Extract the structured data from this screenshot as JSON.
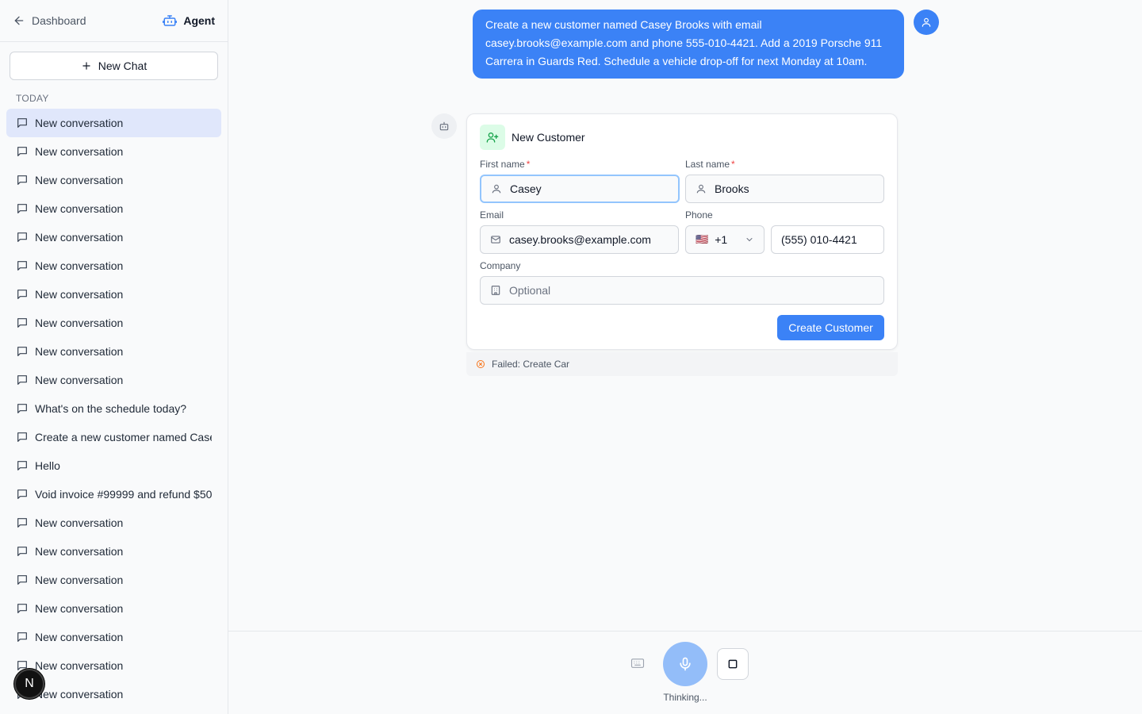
{
  "sidebar": {
    "back_label": "Dashboard",
    "agent_label": "Agent",
    "new_chat_label": "New Chat",
    "section_label": "TODAY",
    "items": [
      {
        "label": "New conversation"
      },
      {
        "label": "New conversation"
      },
      {
        "label": "New conversation"
      },
      {
        "label": "New conversation"
      },
      {
        "label": "New conversation"
      },
      {
        "label": "New conversation"
      },
      {
        "label": "New conversation"
      },
      {
        "label": "New conversation"
      },
      {
        "label": "New conversation"
      },
      {
        "label": "New conversation"
      },
      {
        "label": "What's on the schedule today?"
      },
      {
        "label": "Create a new customer named Case"
      },
      {
        "label": "Hello"
      },
      {
        "label": "Void invoice #99999 and refund $50"
      },
      {
        "label": "New conversation"
      },
      {
        "label": "New conversation"
      },
      {
        "label": "New conversation"
      },
      {
        "label": "New conversation"
      },
      {
        "label": "New conversation"
      },
      {
        "label": "New conversation"
      },
      {
        "label": "New conversation"
      }
    ],
    "badge_letter": "N"
  },
  "chat": {
    "user_message": "Create a new customer named Casey Brooks with email casey.brooks@example.com and phone 555-010-4421. Add a 2019 Porsche 911 Carrera in Guards Red. Schedule a vehicle drop-off for next Monday at 10am."
  },
  "form": {
    "title": "New Customer",
    "first_name_label": "First name",
    "first_name_value": "Casey",
    "last_name_label": "Last name",
    "last_name_value": "Brooks",
    "required_mark": "*",
    "email_label": "Email",
    "email_value": "casey.brooks@example.com",
    "phone_label": "Phone",
    "phone_flag": "🇺🇸",
    "phone_code": "+1",
    "phone_value": "(555) 010-4421",
    "company_label": "Company",
    "company_placeholder": "Optional",
    "submit_label": "Create Customer"
  },
  "status": {
    "failed_text": "Failed: Create Car"
  },
  "bottom": {
    "thinking_label": "Thinking..."
  },
  "colors": {
    "accent": "#3b82f6",
    "mic": "#93bdf9",
    "active_item": "#e0e7fb",
    "icon_green": "#16a34a",
    "error": "#ef4444"
  }
}
